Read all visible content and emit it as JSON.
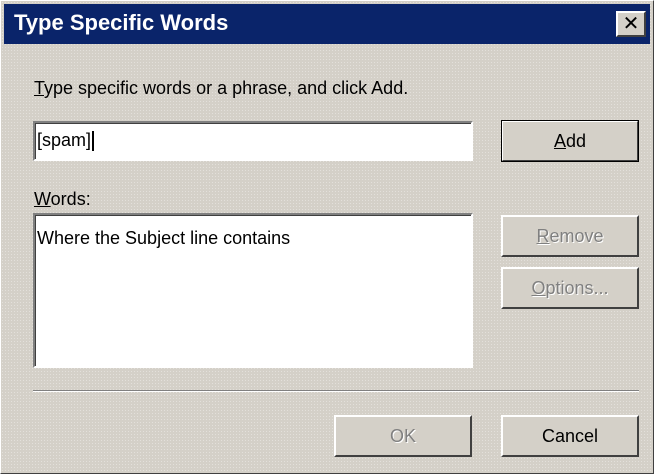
{
  "dialog": {
    "title": "Type Specific Words",
    "close_icon": "close-icon"
  },
  "instruction": {
    "prefix": "T",
    "rest": "ype specific words or a phrase, and click Add."
  },
  "input": {
    "value": "[spam]"
  },
  "words_label": {
    "prefix": "W",
    "rest": "ords:"
  },
  "words_list": {
    "text": "Where the Subject line contains"
  },
  "buttons": {
    "add": {
      "prefix": "A",
      "rest": "dd",
      "enabled": true
    },
    "remove": {
      "prefix": "R",
      "rest": "emove",
      "enabled": false
    },
    "options": {
      "prefix": "O",
      "rest": "ptions...",
      "enabled": false
    },
    "ok": {
      "label": "OK",
      "enabled": false
    },
    "cancel": {
      "label": "Cancel",
      "enabled": true
    }
  }
}
